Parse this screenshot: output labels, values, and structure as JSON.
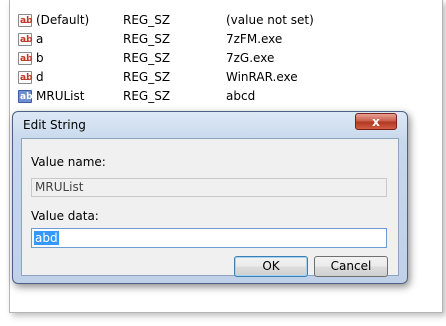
{
  "registry": {
    "rows": [
      {
        "icon": "ab",
        "name": "(Default)",
        "type": "REG_SZ",
        "data": "(value not set)"
      },
      {
        "icon": "ab",
        "name": "a",
        "type": "REG_SZ",
        "data": "7zFM.exe"
      },
      {
        "icon": "ab",
        "name": "b",
        "type": "REG_SZ",
        "data": "7zG.exe"
      },
      {
        "icon": "ab",
        "name": "d",
        "type": "REG_SZ",
        "data": "WinRAR.exe"
      },
      {
        "icon": "ab",
        "name": "MRUList",
        "type": "REG_SZ",
        "data": "abcd"
      }
    ]
  },
  "dialog": {
    "title": "Edit String",
    "close_label": "x",
    "value_name_label": "Value name:",
    "value_name": "MRUList",
    "value_data_label": "Value data:",
    "value_data": "abd",
    "ok_label": "OK",
    "cancel_label": "Cancel"
  },
  "colors": {
    "selection": "#3399ff",
    "close_button": "#c75a48",
    "dialog_frame": "#bfd1e8"
  }
}
